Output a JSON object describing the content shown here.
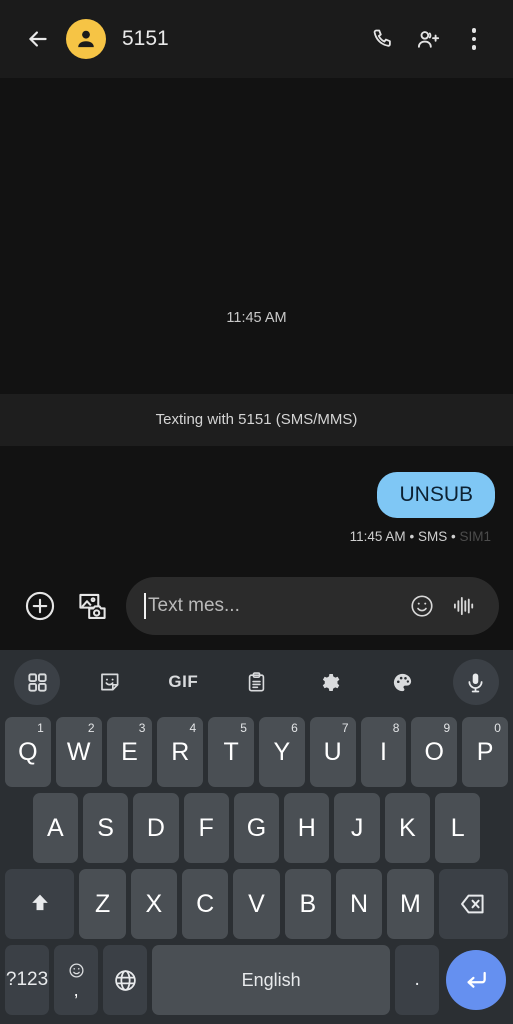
{
  "appbar": {
    "back_icon": "arrow-left-icon",
    "avatar_icon": "person-avatar-icon",
    "avatar_color": "#F6C445",
    "title": "5151",
    "call_icon": "phone-call-icon",
    "add_person_icon": "add-person-icon",
    "overflow_icon": "more-vertical-icon"
  },
  "conversation": {
    "day_timestamp": "11:45 AM",
    "system_banner": "Texting with 5151 (SMS/MMS)",
    "messages": [
      {
        "text": "UNSUB",
        "direction": "outgoing",
        "bubble_color": "#7FC7F5",
        "meta_time": "11:45 AM",
        "meta_sep": "•",
        "meta_type": "SMS",
        "meta_sim": "SIM1"
      }
    ]
  },
  "input_bar": {
    "plus_icon": "plus-circle-icon",
    "gallery_icon": "gallery-camera-icon",
    "placeholder": "Text mes...",
    "emoji_icon": "emoji-smiley-icon",
    "voice_icon": "audio-waveform-icon"
  },
  "keyboard": {
    "toolbar": [
      {
        "name": "apps-grid-icon",
        "label": "",
        "circled": true
      },
      {
        "name": "sticker-icon",
        "label": "",
        "circled": false
      },
      {
        "name": "gif-icon",
        "label": "GIF",
        "circled": false
      },
      {
        "name": "clipboard-icon",
        "label": "",
        "circled": false
      },
      {
        "name": "settings-gear-icon",
        "label": "",
        "circled": false
      },
      {
        "name": "palette-icon",
        "label": "",
        "circled": false
      },
      {
        "name": "microphone-icon",
        "label": "",
        "circled": true
      }
    ],
    "row1": [
      {
        "letter": "Q",
        "sup": "1"
      },
      {
        "letter": "W",
        "sup": "2"
      },
      {
        "letter": "E",
        "sup": "3"
      },
      {
        "letter": "R",
        "sup": "4"
      },
      {
        "letter": "T",
        "sup": "5"
      },
      {
        "letter": "Y",
        "sup": "6"
      },
      {
        "letter": "U",
        "sup": "7"
      },
      {
        "letter": "I",
        "sup": "8"
      },
      {
        "letter": "O",
        "sup": "9"
      },
      {
        "letter": "P",
        "sup": "0"
      }
    ],
    "row2": [
      {
        "letter": "A"
      },
      {
        "letter": "S"
      },
      {
        "letter": "D"
      },
      {
        "letter": "F"
      },
      {
        "letter": "G"
      },
      {
        "letter": "H"
      },
      {
        "letter": "J"
      },
      {
        "letter": "K"
      },
      {
        "letter": "L"
      }
    ],
    "row3": [
      {
        "letter": "Z"
      },
      {
        "letter": "X"
      },
      {
        "letter": "C"
      },
      {
        "letter": "V"
      },
      {
        "letter": "B"
      },
      {
        "letter": "N"
      },
      {
        "letter": "M"
      }
    ],
    "shift_icon": "shift-arrow-icon",
    "backspace_icon": "backspace-icon",
    "symbols_label": "?123",
    "emoji_key_top": "emoji-smiley-icon",
    "emoji_key_bottom": ",",
    "language_icon": "globe-icon",
    "space_label": "English",
    "period_label": ".",
    "enter_icon": "enter-return-icon",
    "enter_color": "#6590F0"
  }
}
